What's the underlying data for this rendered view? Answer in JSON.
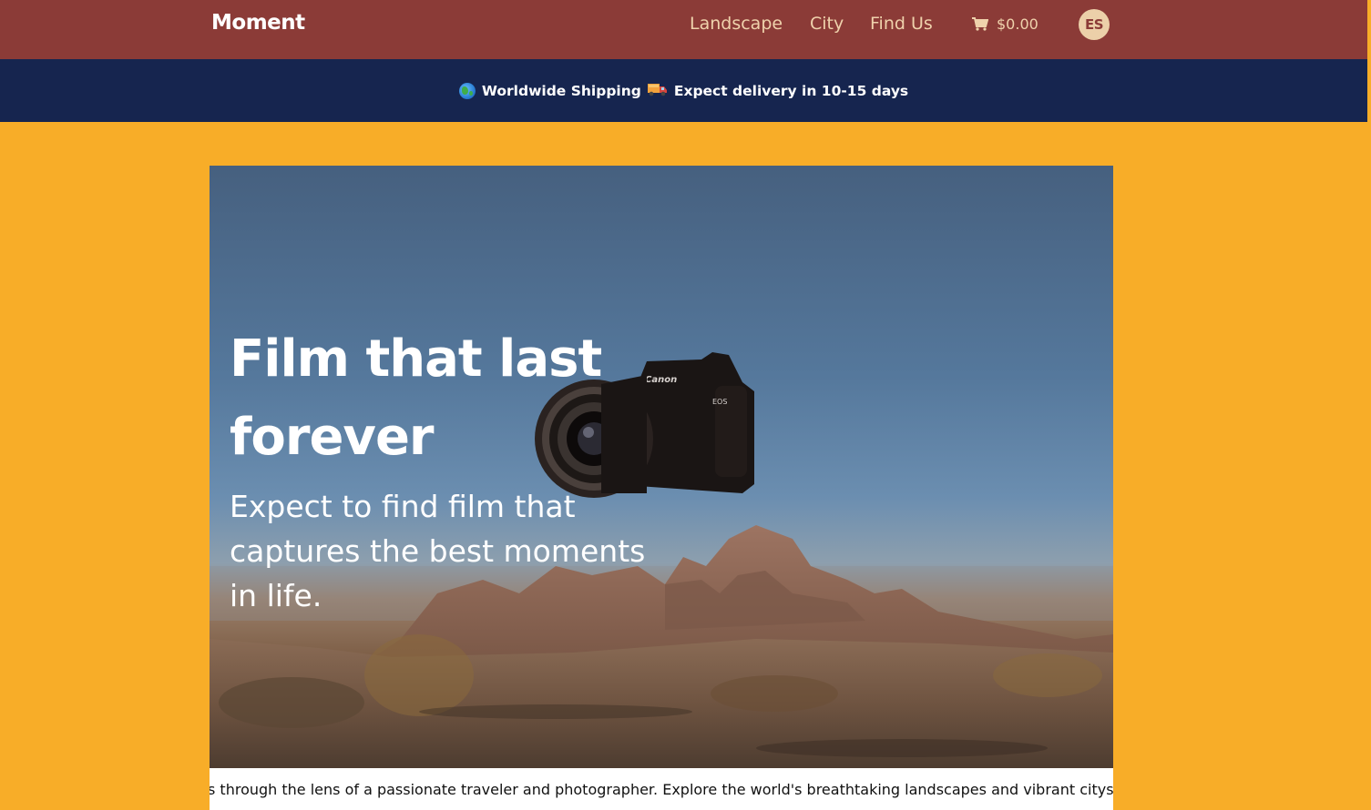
{
  "brand": {
    "name": "Moment"
  },
  "nav": {
    "links": [
      "Landscape",
      "City",
      "Find Us"
    ],
    "cart_total": "$0.00",
    "avatar_initials": "ES"
  },
  "shipping_bar": {
    "part1": "Worldwide Shipping",
    "part2": "Expect delivery in 10-15 days"
  },
  "hero": {
    "title_line1": "Film that last",
    "title_line2": "forever",
    "subtitle": "Expect to find film that captures the best moments in life.",
    "camera_brand": "Canon",
    "camera_model": "EOS"
  },
  "marquee": {
    "text": "s through the lens of a passionate traveler and photographer. Explore the world's breathtaking landscapes and vibrant cityscap"
  },
  "colors": {
    "topbar": "#8b3b37",
    "shipbar": "#16254f",
    "page_bg": "#f8ad28",
    "nav_text": "#efd2ac"
  },
  "icons": [
    "cart-icon",
    "globe-icon",
    "truck-icon"
  ]
}
